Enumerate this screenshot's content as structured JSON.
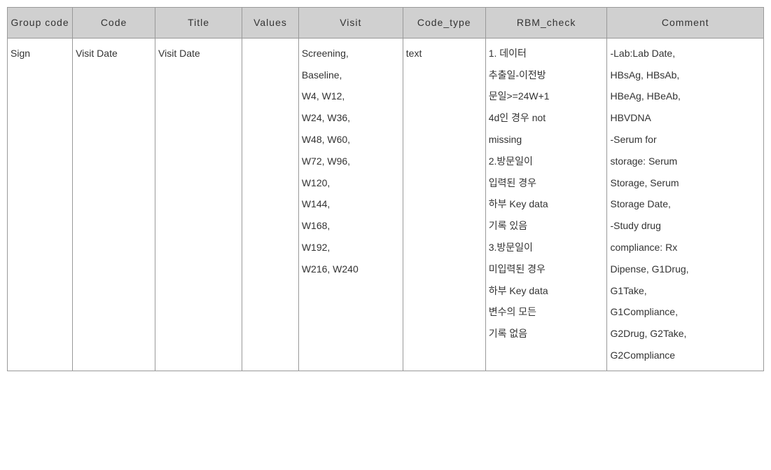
{
  "table": {
    "headers": {
      "group_code": "Group code",
      "code": "Code",
      "title": "Title",
      "values": "Values",
      "visit": "Visit",
      "code_type": "Code_type",
      "rbm_check": "RBM_check",
      "comment": "Comment"
    },
    "rows": [
      {
        "group_code": "Sign",
        "code": "Visit Date",
        "title": "Visit Date",
        "values": "",
        "visit": "Screening,\nBaseline,\nW4, W12,\nW24, W36,\nW48, W60,\nW72, W96,\nW120,\nW144,\nW168,\nW192,\nW216, W240",
        "code_type": "text",
        "rbm_check": "1. 데이터\n추출일-이전방\n문일>=24W+1\n4d인 경우 not\nmissing\n2.방문일이\n입력된 경우\n하부 Key data\n기록 있음\n3.방문일이\n미입력된 경우\n하부 Key data\n변수의 모든\n기록 없음",
        "comment": "-Lab:Lab Date,\nHBsAg, HBsAb,\nHBeAg, HBeAb,\nHBVDNA\n-Serum for\nstorage: Serum\nStorage, Serum\nStorage Date,\n-Study drug\ncompliance: Rx\nDipense, G1Drug,\nG1Take,\nG1Compliance,\nG2Drug, G2Take,\nG2Compliance"
      }
    ]
  }
}
